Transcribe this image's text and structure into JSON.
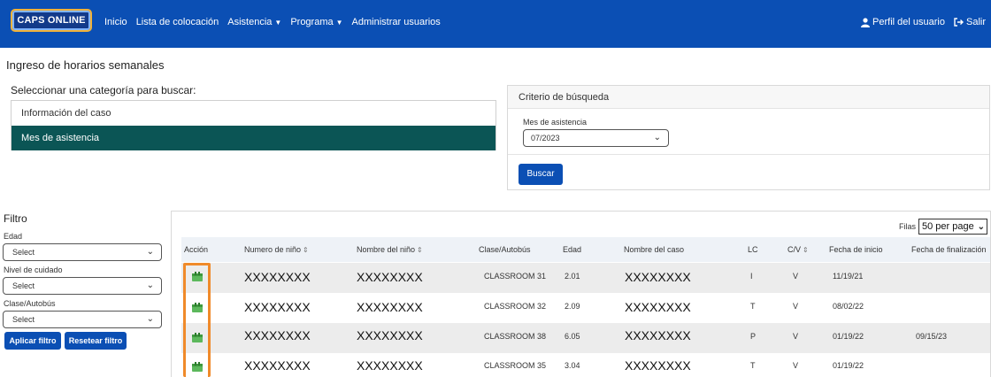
{
  "header": {
    "logo_text": "CAPS ONLINE",
    "nav": [
      {
        "label": "Inicio",
        "dropdown": false
      },
      {
        "label": "Lista de colocación",
        "dropdown": false
      },
      {
        "label": "Asistencia",
        "dropdown": true
      },
      {
        "label": "Programa",
        "dropdown": true
      },
      {
        "label": "Administrar usuarios",
        "dropdown": false
      }
    ],
    "profile_label": "Perfil del usuario",
    "logout_label": "Salir",
    "brand_color": "#0b4fb4"
  },
  "page": {
    "title": "Ingreso de horarios semanales",
    "category_prompt": "Seleccionar una categoría para buscar:",
    "categories": [
      {
        "label": "Información del caso",
        "active": false
      },
      {
        "label": "Mes de asistencia",
        "active": true
      }
    ]
  },
  "criteria": {
    "title": "Criterio de búsqueda",
    "month_label": "Mes de asistencia",
    "month_value": "07/2023",
    "search_button": "Buscar"
  },
  "filter": {
    "title": "Filtro",
    "edad_label": "Edad",
    "edad_value": "Select",
    "nivel_label": "Nivel de cuidado",
    "nivel_value": "Select",
    "clase_label": "Clase/Autobús",
    "clase_value": "Select",
    "apply_button": "Aplicar filtro",
    "reset_button": "Resetear filtro"
  },
  "table": {
    "rows_label": "Filas",
    "rows_value": "50 per page",
    "columns": {
      "accion": "Acción",
      "numero": "Numero de niño",
      "nombre": "Nombre del niño",
      "clase": "Clase/Autobús",
      "edad": "Edad",
      "caso": "Nombre del caso",
      "lc": "LC",
      "cv": "C/V",
      "inicio": "Fecha de inicio",
      "fin": "Fecha de finalización"
    },
    "rows": [
      {
        "numero": "XXXXXXXX",
        "nombre": "XXXXXXXX",
        "clase": "CLASSROOM 31",
        "edad": "2.01",
        "caso": "XXXXXXXX",
        "lc": "I",
        "cv": "V",
        "inicio": "11/19/21",
        "fin": ""
      },
      {
        "numero": "XXXXXXXX",
        "nombre": "XXXXXXXX",
        "clase": "CLASSROOM 32",
        "edad": "2.09",
        "caso": "XXXXXXXX",
        "lc": "T",
        "cv": "V",
        "inicio": "08/02/22",
        "fin": ""
      },
      {
        "numero": "XXXXXXXX",
        "nombre": "XXXXXXXX",
        "clase": "CLASSROOM 38",
        "edad": "6.05",
        "caso": "XXXXXXXX",
        "lc": "P",
        "cv": "V",
        "inicio": "01/19/22",
        "fin": "09/15/23"
      },
      {
        "numero": "XXXXXXXX",
        "nombre": "XXXXXXXX",
        "clase": "CLASSROOM 35",
        "edad": "3.04",
        "caso": "XXXXXXXX",
        "lc": "T",
        "cv": "V",
        "inicio": "01/19/22",
        "fin": ""
      }
    ]
  }
}
